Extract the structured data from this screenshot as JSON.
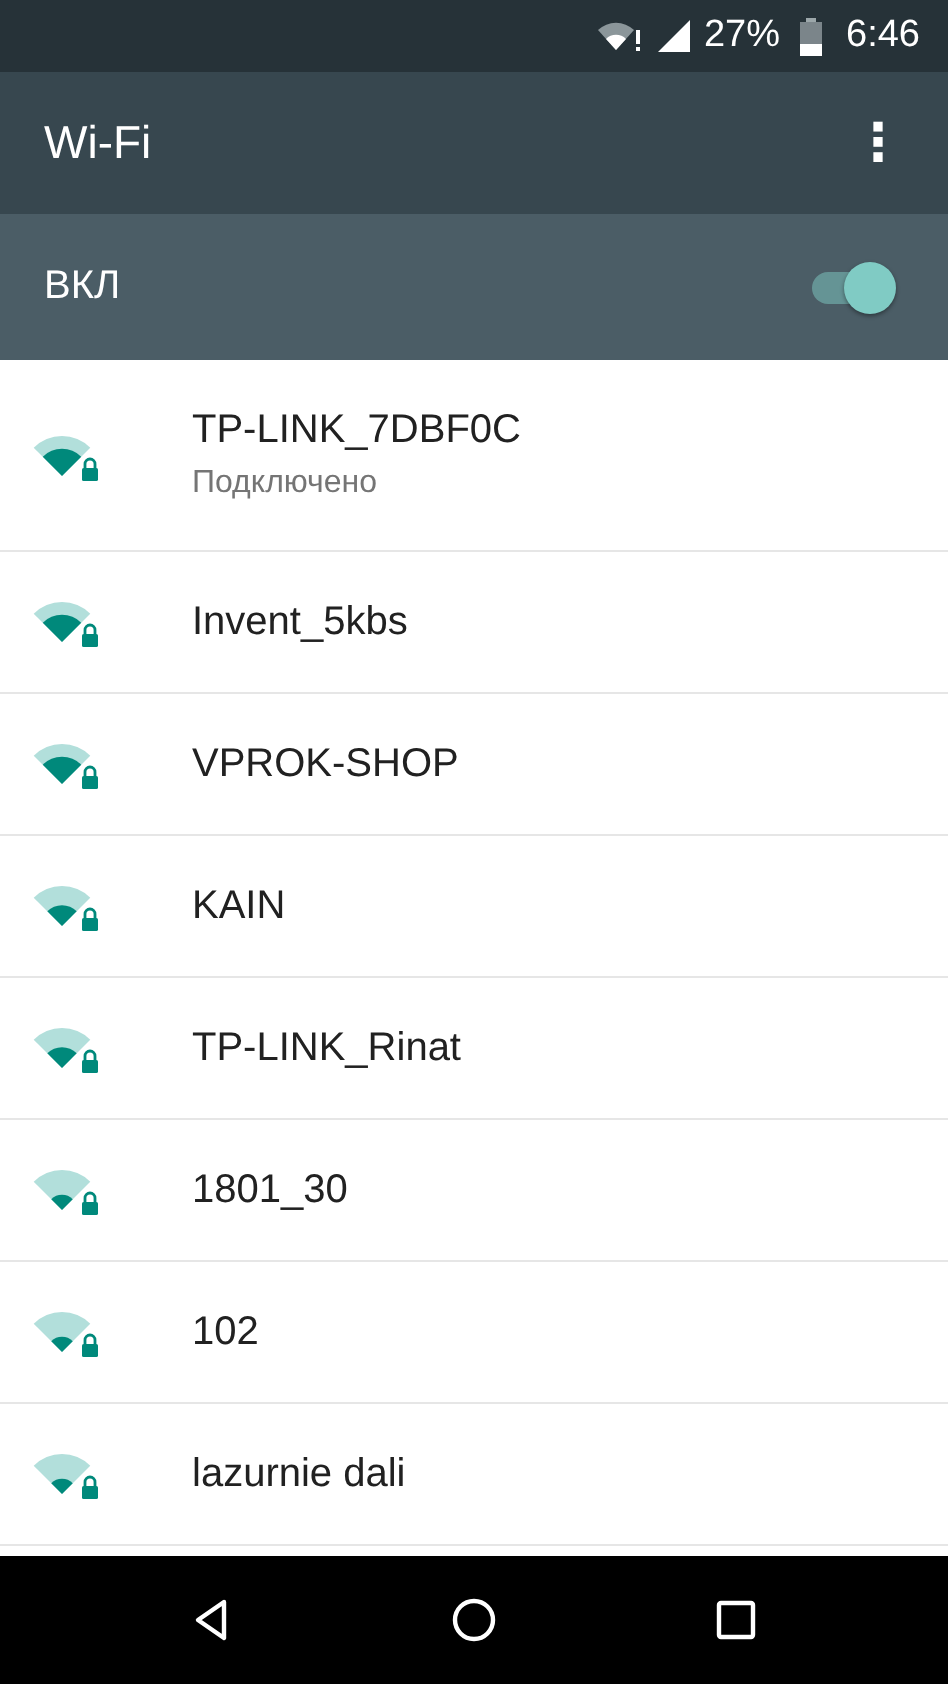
{
  "status_bar": {
    "battery": "27%",
    "time": "6:46"
  },
  "app_bar": {
    "title": "Wi-Fi",
    "menu": "⋮"
  },
  "master_switch": {
    "label": "ВКЛ",
    "on": true
  },
  "networks": [
    {
      "name": "TP-LINK_7DBF0C",
      "status": "Подключено",
      "kind": "high"
    },
    {
      "name": "Invent_5kbs",
      "kind": "high"
    },
    {
      "name": "VPROK-SHOP",
      "kind": "high"
    },
    {
      "name": "KAIN",
      "kind": "mid"
    },
    {
      "name": "TP-LINK_Rinat",
      "kind": "mid"
    },
    {
      "name": "1801_30",
      "kind": "low"
    },
    {
      "name": "102",
      "kind": "low"
    },
    {
      "name": "lazurnie dali",
      "kind": "low"
    }
  ]
}
